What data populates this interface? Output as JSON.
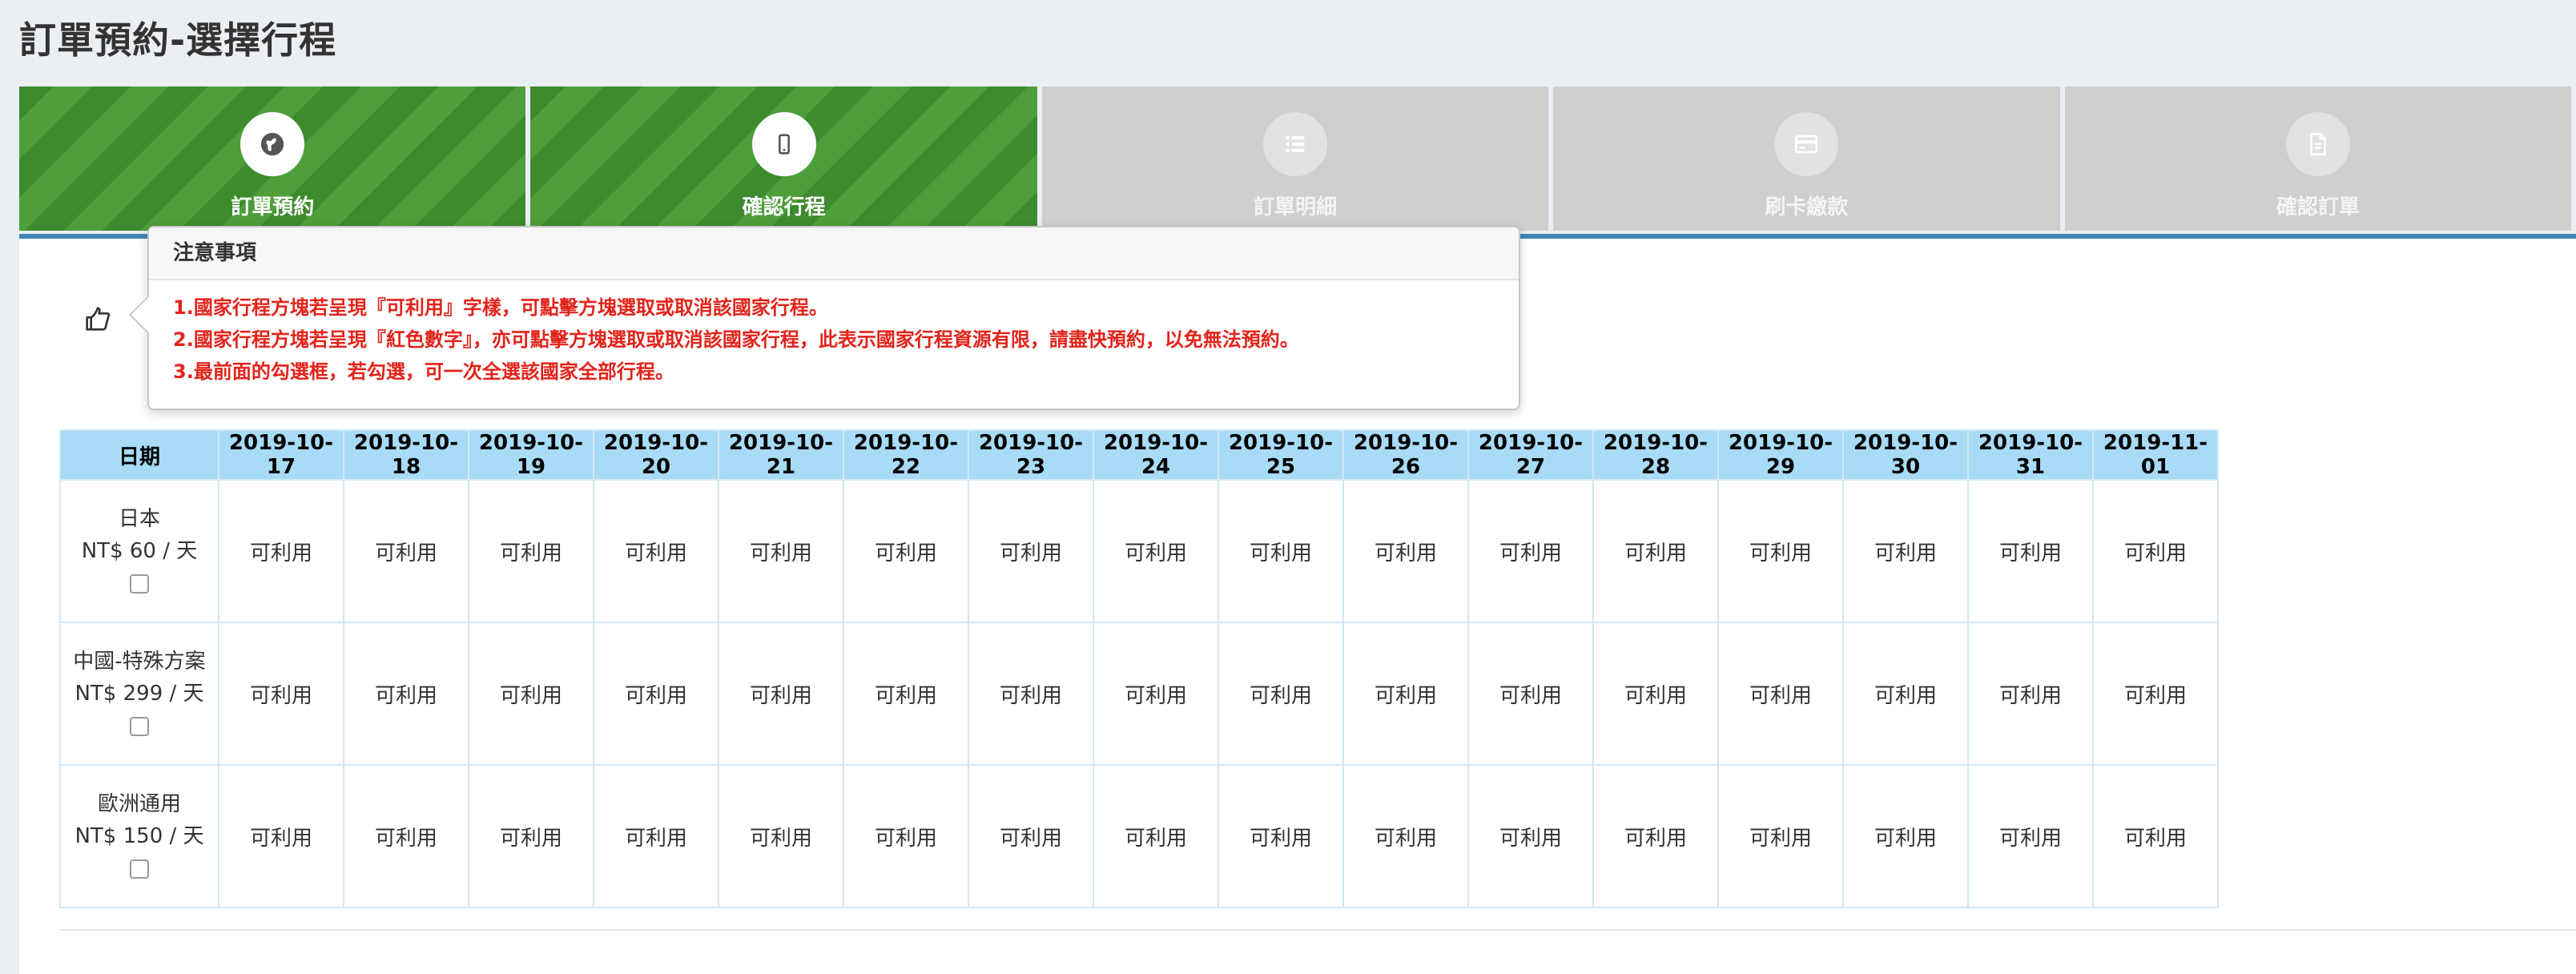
{
  "page": {
    "title": "訂單預約-選擇行程"
  },
  "steps": [
    {
      "label": "訂單預約",
      "icon": "globe-icon",
      "active": true
    },
    {
      "label": "確認行程",
      "icon": "mobile-icon",
      "active": true
    },
    {
      "label": "訂單明細",
      "icon": "list-icon",
      "active": false
    },
    {
      "label": "刷卡繳款",
      "icon": "credit-card-icon",
      "active": false
    },
    {
      "label": "確認訂單",
      "icon": "document-icon",
      "active": false
    }
  ],
  "notice": {
    "title": "注意事項",
    "lines": [
      "1.國家行程方塊若呈現『可利用』字樣，可點擊方塊選取或取消該國家行程。",
      "2.國家行程方塊若呈現『紅色數字』，亦可點擊方塊選取或取消該國家行程，此表示國家行程資源有限，請盡快預約，以免無法預約。",
      "3.最前面的勾選框，若勾選，可一次全選該國家全部行程。"
    ]
  },
  "table": {
    "date_header": "日期",
    "dates": [
      "2019-10-17",
      "2019-10-18",
      "2019-10-19",
      "2019-10-20",
      "2019-10-21",
      "2019-10-22",
      "2019-10-23",
      "2019-10-24",
      "2019-10-25",
      "2019-10-26",
      "2019-10-27",
      "2019-10-28",
      "2019-10-29",
      "2019-10-30",
      "2019-10-31",
      "2019-11-01"
    ],
    "rows": [
      {
        "name": "日本",
        "price": "NT$ 60 / 天",
        "cell": "可利用"
      },
      {
        "name": "中國-特殊方案",
        "price": "NT$ 299 / 天",
        "cell": "可利用"
      },
      {
        "name": "歐洲通用",
        "price": "NT$ 150 / 天",
        "cell": "可利用"
      }
    ]
  },
  "colors": {
    "active_step": "#3e8a2e",
    "inactive_step": "#cfcfcf",
    "table_header": "#a8dbf6",
    "notice_text": "#e2231a",
    "content_top_border": "#3d87b8"
  }
}
